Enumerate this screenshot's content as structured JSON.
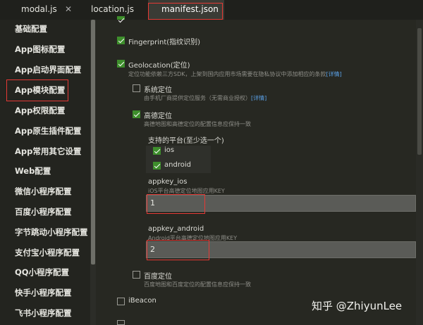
{
  "tabs": [
    {
      "label": "modal.js",
      "close": "✕"
    },
    {
      "label": "location.js"
    },
    {
      "label": "manifest.json"
    }
  ],
  "sidebar": {
    "items": [
      {
        "label": "基础配置"
      },
      {
        "label": "App图标配置"
      },
      {
        "label": "App启动界面配置"
      },
      {
        "label": "App模块配置"
      },
      {
        "label": "App权限配置"
      },
      {
        "label": "App原生插件配置"
      },
      {
        "label": "App常用其它设置"
      },
      {
        "label": "Web配置"
      },
      {
        "label": "微信小程序配置"
      },
      {
        "label": "百度小程序配置"
      },
      {
        "label": "字节跳动小程序配置"
      },
      {
        "label": "支付宝小程序配置"
      },
      {
        "label": "QQ小程序配置"
      },
      {
        "label": "快手小程序配置"
      },
      {
        "label": "飞书小程序配置"
      }
    ]
  },
  "modules": {
    "fingerprint": {
      "label": "Fingerprint(指纹识别)"
    },
    "geolocation": {
      "label": "Geolocation(定位)",
      "desc": "定位功能依赖三方SDK，上架到国内应用市场需要在隐私协议中添加相应的条款",
      "desc_link": "[详情]"
    },
    "system_loc": {
      "label": "系统定位",
      "desc": "由手机厂商提供定位服务（无需商业授权）",
      "desc_link": "[详情]"
    },
    "amap_loc": {
      "label": "高德定位",
      "desc": "高德地图和高德定位的配置信息应保持一致"
    },
    "platforms": {
      "label": "支持的平台(至少选一个)",
      "ios": "ios",
      "android": "android"
    },
    "appkey_ios": {
      "label": "appkey_ios",
      "desc": "iOS平台高德定位地图应用KEY",
      "value": "1"
    },
    "appkey_android": {
      "label": "appkey_android",
      "desc": "Android平台高德定位地图应用KEY",
      "value": "2"
    },
    "baidu_loc": {
      "label": "百度定位",
      "desc": "百度地图和百度定位的配置信息应保持一致"
    },
    "ibeacon": {
      "label": "iBeacon"
    }
  },
  "watermark": "知乎 @ZhiyunLee"
}
